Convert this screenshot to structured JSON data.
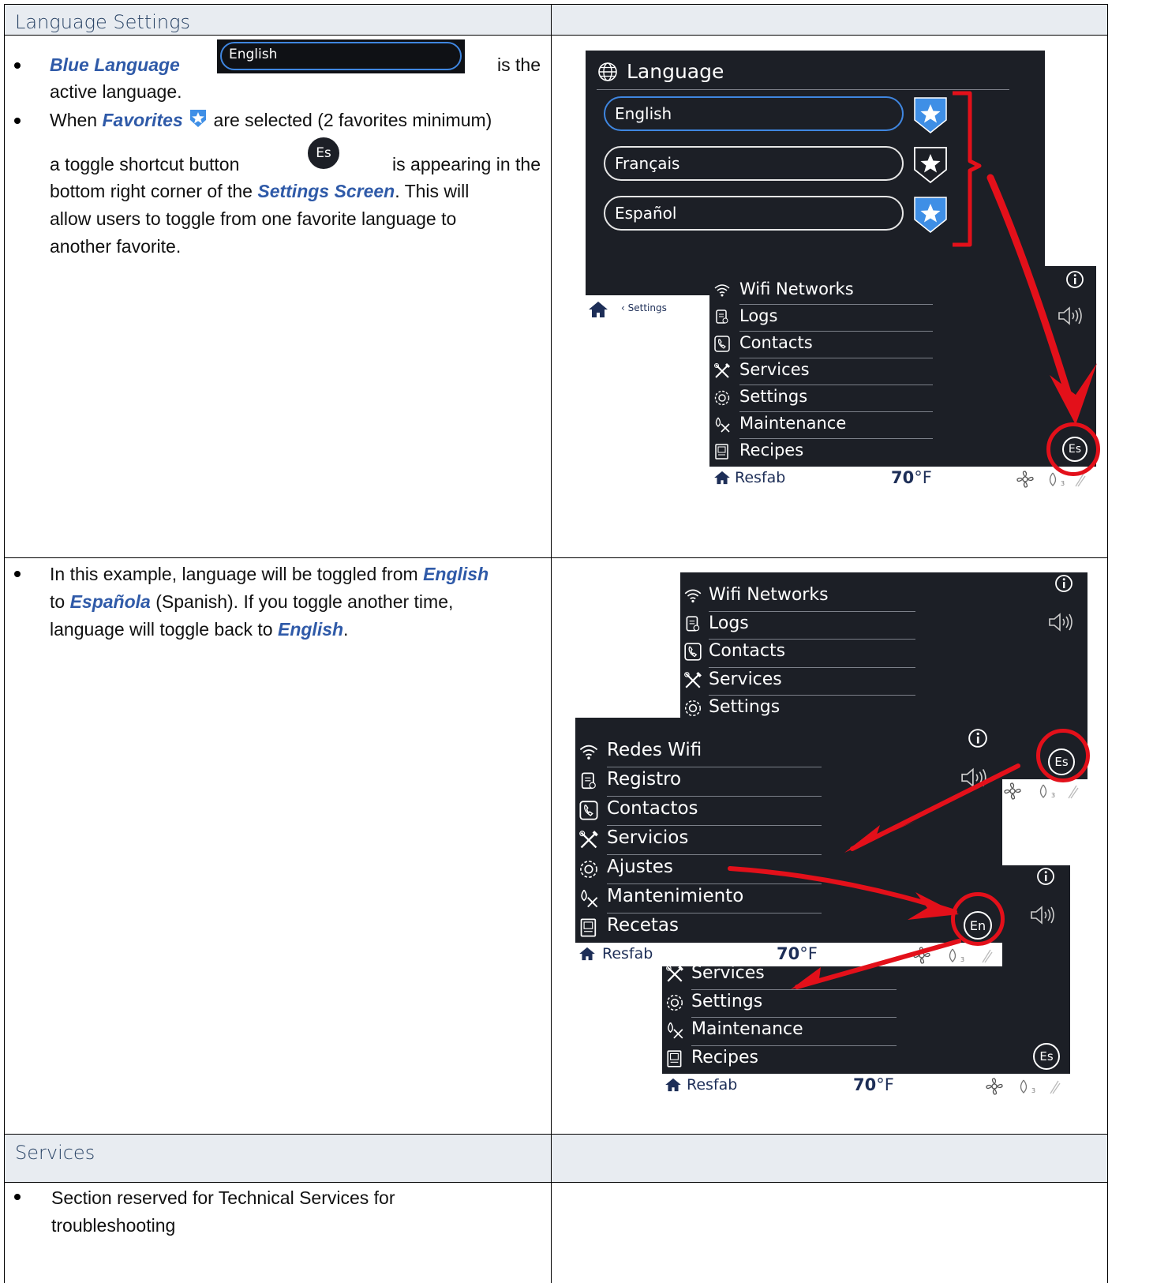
{
  "section1": {
    "heading": "Language Settings",
    "bullet1": {
      "em": "Blue  Language",
      "pill_label": "English",
      "after": "is  the",
      "line2": "active language."
    },
    "bullet2": {
      "before": "When",
      "em": "Favorites",
      "after": "are selected (2 favorites minimum)",
      "line2_before": "a  toggle  shortcut  button",
      "toggle_label": "Es",
      "line2_after": "is  appearing  in  the",
      "line3_before": "bottom right corner of the",
      "line3_em": "Settings Screen",
      "line3_after": ". This will",
      "line4": "allow users to toggle from one favorite language to",
      "line5": "another favorite."
    },
    "screenshot": {
      "title": "Language",
      "languages": [
        {
          "label": "English",
          "favorite": true
        },
        {
          "label": "Français",
          "favorite": false
        },
        {
          "label": "Español",
          "favorite": true
        }
      ],
      "breadcrumb": "Settings",
      "menu": [
        "Wifi Networks",
        "Logs",
        "Contacts",
        "Services",
        "Settings",
        "Maintenance",
        "Recipes"
      ],
      "toggle": "Es",
      "status": {
        "brand": "Resfab",
        "temp": "70",
        "unit": "°F"
      }
    }
  },
  "section2": {
    "line1_before": "In this example, language will be toggled from",
    "line1_em": "English",
    "line2_before": "to",
    "line2_em": "Española",
    "line2_after": "(Spanish).  If you toggle another time,",
    "line3_before": "language will toggle back to",
    "line3_em": "English",
    "line3_after": ".",
    "screen_en_top": [
      "Wifi Networks",
      "Logs",
      "Contacts",
      "Services",
      "Settings"
    ],
    "screen_es": [
      "Redes Wifi",
      "Registro",
      "Contactos",
      "Servicios",
      "Ajustes",
      "Mantenimiento",
      "Recetas"
    ],
    "screen_en_bottom": [
      "Services",
      "Settings",
      "Maintenance",
      "Recipes"
    ],
    "toggle_es": "Es",
    "toggle_en": "En",
    "status": {
      "brand": "Resfab",
      "temp": "70",
      "unit": "°F"
    }
  },
  "section3": {
    "heading": "Services",
    "text_line1": "Section reserved for Technical Services for",
    "text_line2": "troubleshooting"
  },
  "colors": {
    "accent": "#2f5aa8",
    "heading": "#2a4466",
    "screen": "#1c1f26",
    "red": "#e3101a"
  }
}
